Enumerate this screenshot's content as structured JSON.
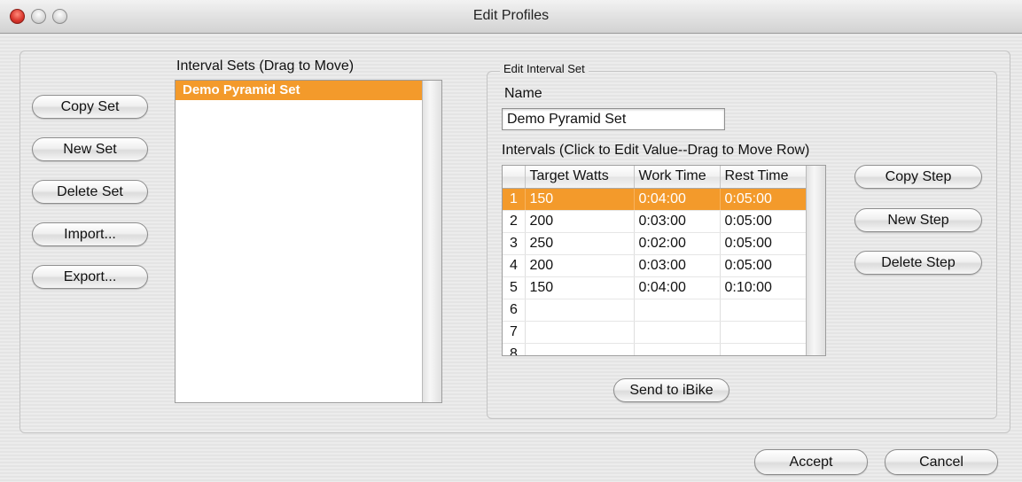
{
  "window": {
    "title": "Edit Profiles"
  },
  "left_buttons": {
    "copy_set": "Copy Set",
    "new_set": "New Set",
    "delete_set": "Delete Set",
    "import": "Import...",
    "export": "Export..."
  },
  "interval_sets": {
    "label": "Interval Sets (Drag to Move)",
    "items": [
      "Demo Pyramid Set"
    ],
    "selected": "Demo Pyramid Set"
  },
  "edit_interval_set": {
    "legend": "Edit Interval Set",
    "name_label": "Name",
    "name_value": "Demo Pyramid Set",
    "intervals_label": "Intervals (Click to Edit Value--Drag to Move Row)",
    "columns": [
      "",
      "Target Watts",
      "Work Time",
      "Rest Time"
    ],
    "rows": [
      {
        "num": "1",
        "watts": "150",
        "work": "0:04:00",
        "rest": "0:05:00"
      },
      {
        "num": "2",
        "watts": "200",
        "work": "0:03:00",
        "rest": "0:05:00"
      },
      {
        "num": "3",
        "watts": "250",
        "work": "0:02:00",
        "rest": "0:05:00"
      },
      {
        "num": "4",
        "watts": "200",
        "work": "0:03:00",
        "rest": "0:05:00"
      },
      {
        "num": "5",
        "watts": "150",
        "work": "0:04:00",
        "rest": "0:10:00"
      },
      {
        "num": "6",
        "watts": "",
        "work": "",
        "rest": ""
      },
      {
        "num": "7",
        "watts": "",
        "work": "",
        "rest": ""
      },
      {
        "num": "8",
        "watts": "",
        "work": "",
        "rest": ""
      }
    ],
    "selected_row": "1",
    "step_buttons": {
      "copy_step": "Copy Step",
      "new_step": "New Step",
      "delete_step": "Delete Step"
    },
    "send_button": "Send to iBike"
  },
  "footer": {
    "accept": "Accept",
    "cancel": "Cancel"
  },
  "colors": {
    "selection": "#f39a2b",
    "close_button": "#d8332a"
  }
}
